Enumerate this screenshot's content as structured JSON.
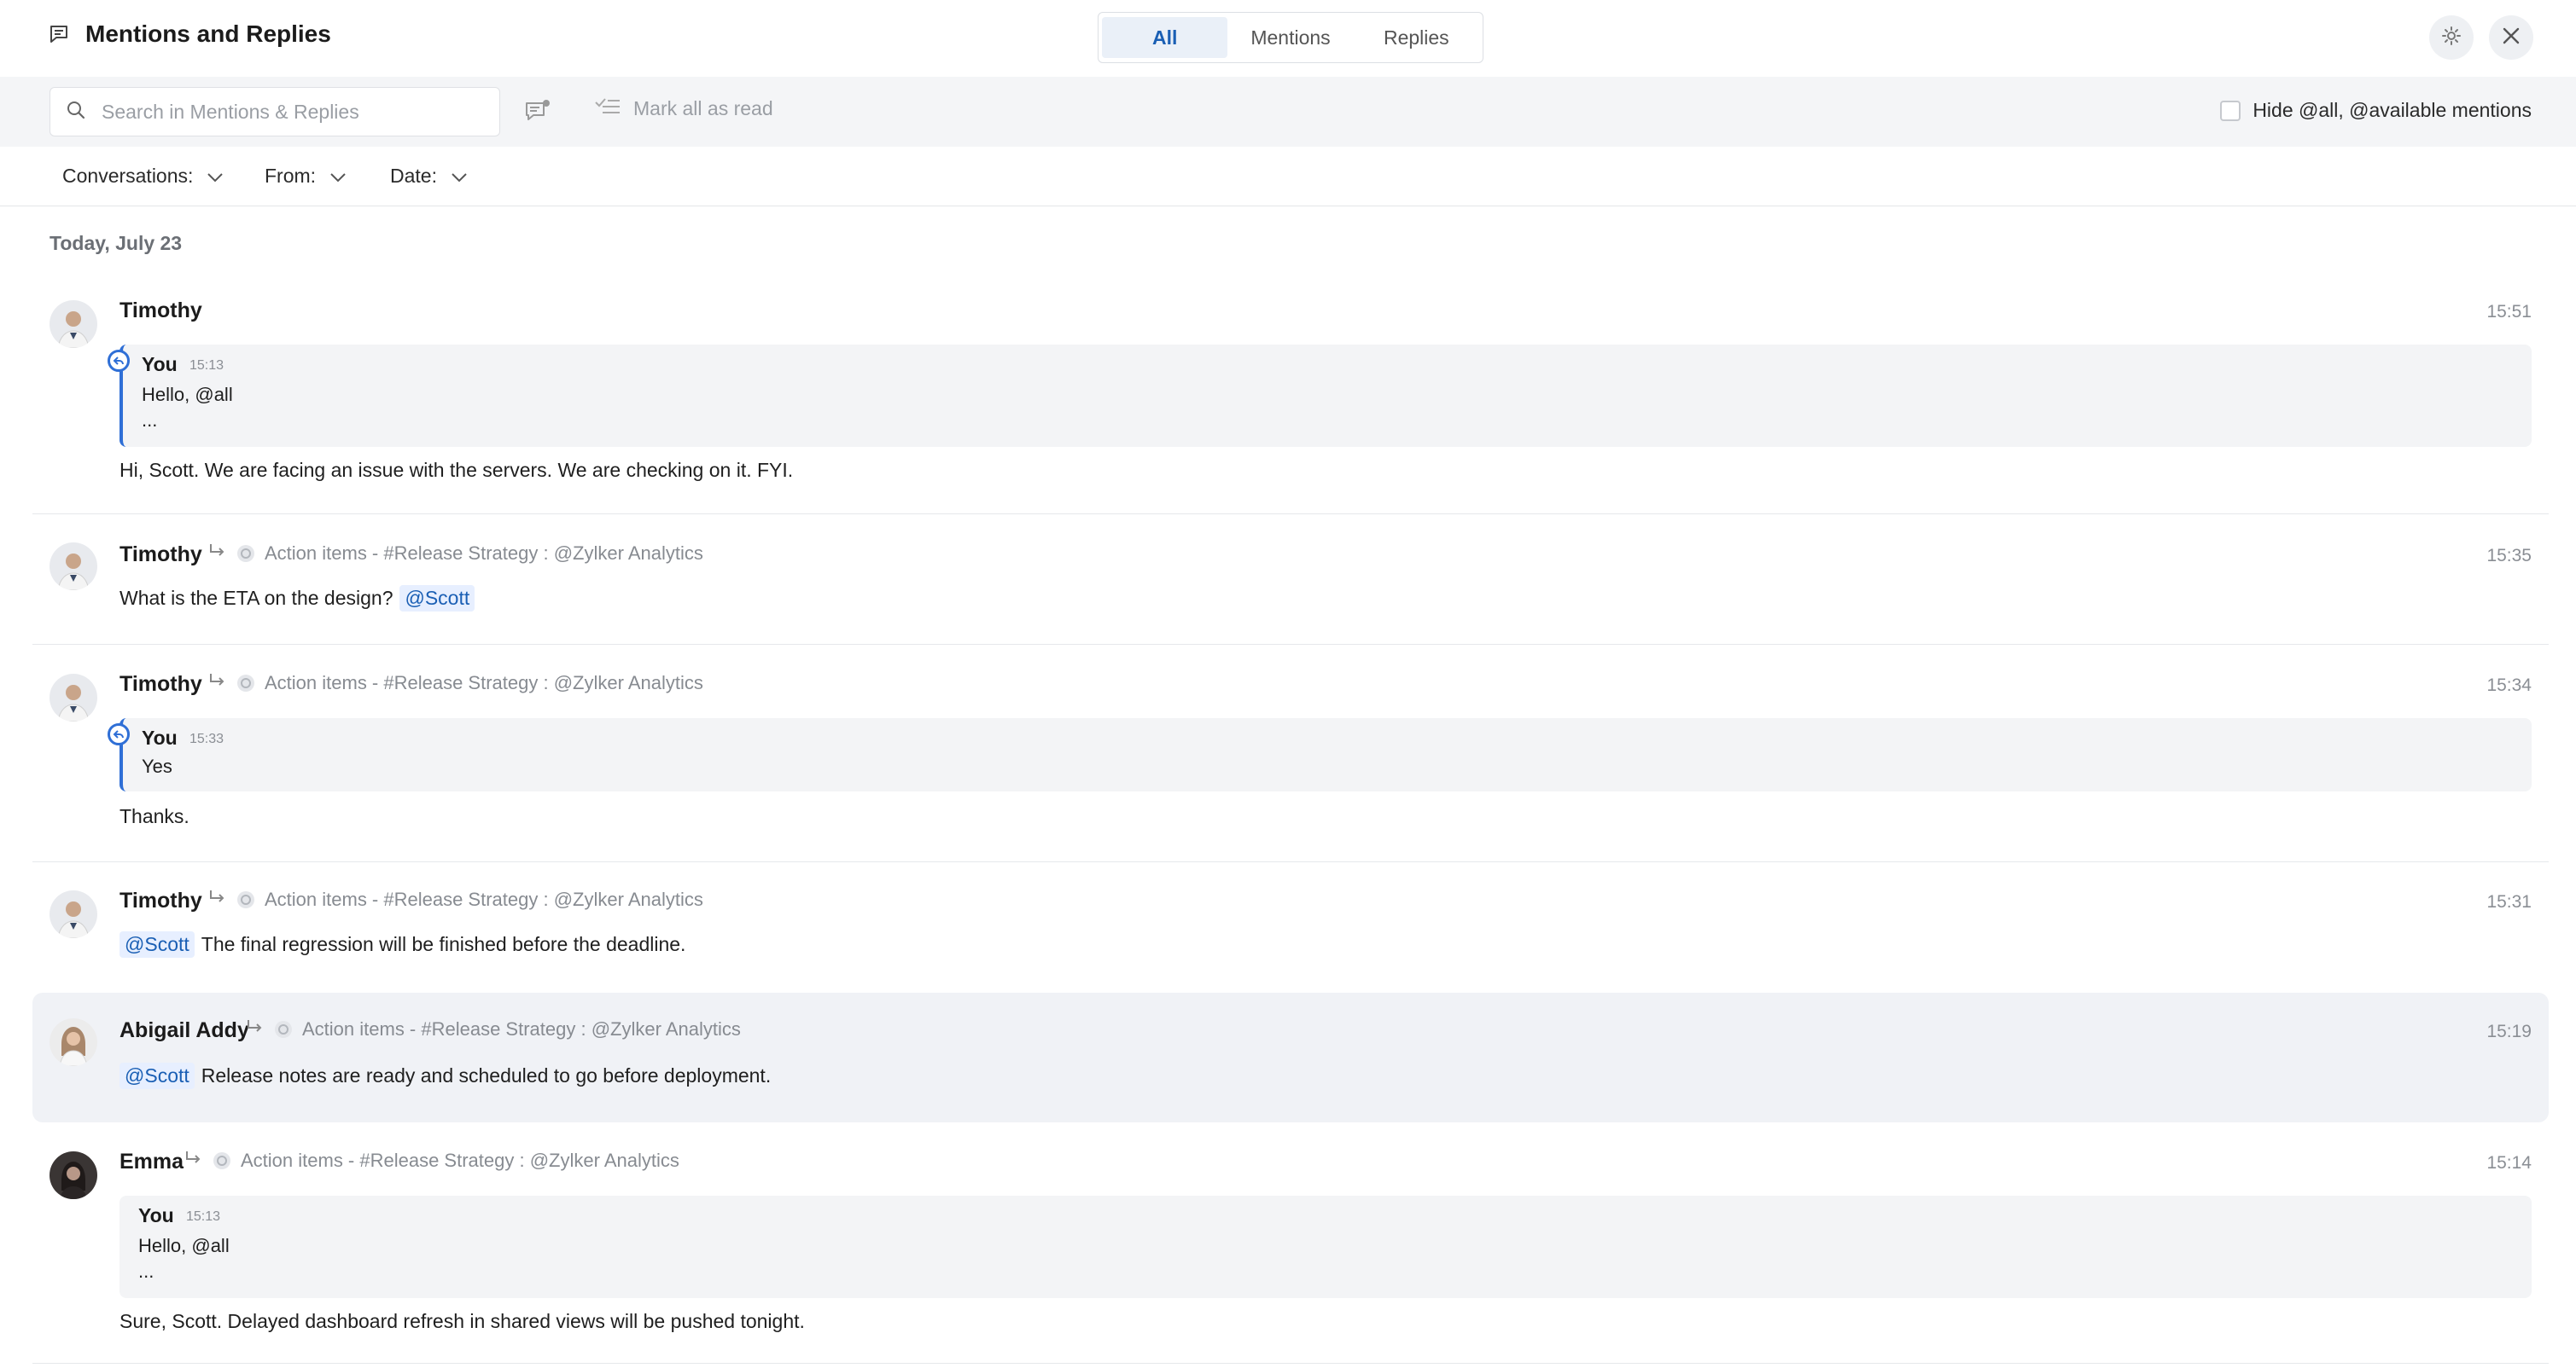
{
  "header": {
    "title": "Mentions and Replies",
    "tabs": [
      "All",
      "Mentions",
      "Replies"
    ],
    "active_tab": "All"
  },
  "toolbar": {
    "search_placeholder": "Search in Mentions & Replies",
    "mark_all_read": "Mark all as read",
    "hide_label": "Hide @all, @available mentions"
  },
  "filters": {
    "conversations": "Conversations:",
    "from": "From:",
    "date": "Date:"
  },
  "date_group": "Today, July 23",
  "messages": [
    {
      "sender": "Timothy",
      "time": "15:51",
      "quote": {
        "author": "You",
        "time": "15:13",
        "line1": "Hello, @all",
        "line2": "..."
      },
      "body": "Hi, Scott. We are facing an issue with the servers. We are checking on it. FYI."
    },
    {
      "sender": "Timothy",
      "time": "15:35",
      "context": "Action items - #Release Strategy : @Zylker Analytics",
      "body": "What is the ETA on the design?",
      "mention": "@Scott"
    },
    {
      "sender": "Timothy",
      "time": "15:34",
      "context": "Action items - #Release Strategy : @Zylker Analytics",
      "quote": {
        "author": "You",
        "time": "15:33",
        "line1": "Yes"
      },
      "body": "Thanks."
    },
    {
      "sender": "Timothy",
      "time": "15:31",
      "context": "Action items - #Release Strategy : @Zylker Analytics",
      "mention": "@Scott",
      "body": "The final regression will be finished before the deadline."
    },
    {
      "sender": "Abigail Addy",
      "time": "15:19",
      "context": "Action items - #Release Strategy : @Zylker Analytics",
      "mention": "@Scott",
      "body": "Release notes are ready and scheduled to go before deployment."
    },
    {
      "sender": "Emma",
      "time": "15:14",
      "context": "Action items - #Release Strategy : @Zylker Analytics",
      "quote": {
        "author": "You",
        "time": "15:13",
        "line1": "Hello, @all",
        "line2": "..."
      },
      "body": "Sure, Scott. Delayed dashboard refresh in shared views will be pushed tonight."
    }
  ],
  "colors": {
    "accent": "#2f6fd6",
    "highlight_row": "#f0f2f6",
    "mention_bg": "#e7efff"
  }
}
